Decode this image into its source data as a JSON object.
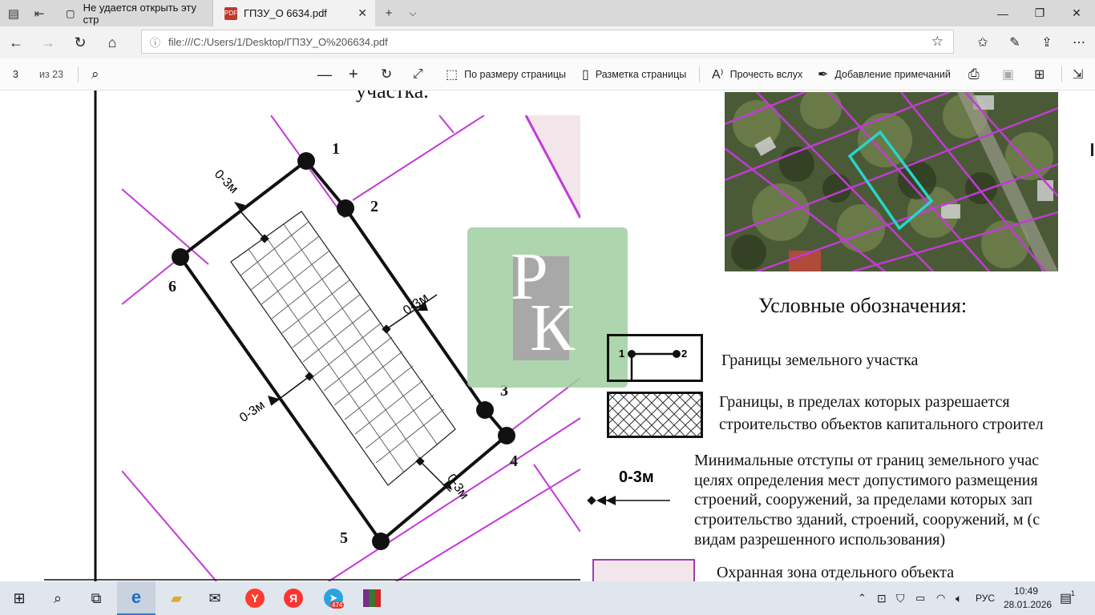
{
  "browser": {
    "tabs": [
      {
        "title": "Не удается открыть эту стр",
        "active": false
      },
      {
        "title": "ГПЗУ_О 6634.pdf",
        "active": true
      }
    ],
    "address": "file:///C:/Users/1/Desktop/ГПЗУ_О%206634.pdf"
  },
  "pdf_toolbar": {
    "page_current": "3",
    "page_total": "из 23",
    "fit_page": "По размеру страницы",
    "page_layout": "Разметка страницы",
    "read_aloud": "Прочесть вслух",
    "add_notes": "Добавление примечаний"
  },
  "document": {
    "heading_fragment": "участка.",
    "point_labels": [
      "1",
      "2",
      "3",
      "4",
      "5",
      "6"
    ],
    "offset_labels": [
      "0-3м",
      "0-3м",
      "0-3м",
      "0-3м"
    ],
    "legend_title": "Условные обозначения:",
    "legend": {
      "boundary": "Границы земельного участка",
      "boundary_sample_points": [
        "1",
        "2"
      ],
      "building_zone_line1": "Границы, в пределах которых разрешается",
      "building_zone_line2": "строительство объектов капитального строител",
      "offset_sample": "0-3м",
      "offset_lines": [
        "Минимальные отступы от границ земельного учас",
        "целях определения мест допустимого размещения",
        "строений, сооружений, за пределами которых зап",
        "строительство зданий, строений, сооружений, м (с",
        "видам разрешенного использования)"
      ],
      "protection_zone": "Охранная зона отдельного объекта"
    },
    "watermark": {
      "letters": [
        "Р",
        "К"
      ]
    },
    "colors": {
      "plot_outline": "#2ad4c8",
      "parcel_lines": "#c13bd6",
      "watermark_bg": "#9fcea0"
    }
  },
  "taskbar": {
    "telegram_badge": "474",
    "lang": "РУС",
    "time": "10:49",
    "date": "28.01.2026",
    "notifications": "1"
  }
}
